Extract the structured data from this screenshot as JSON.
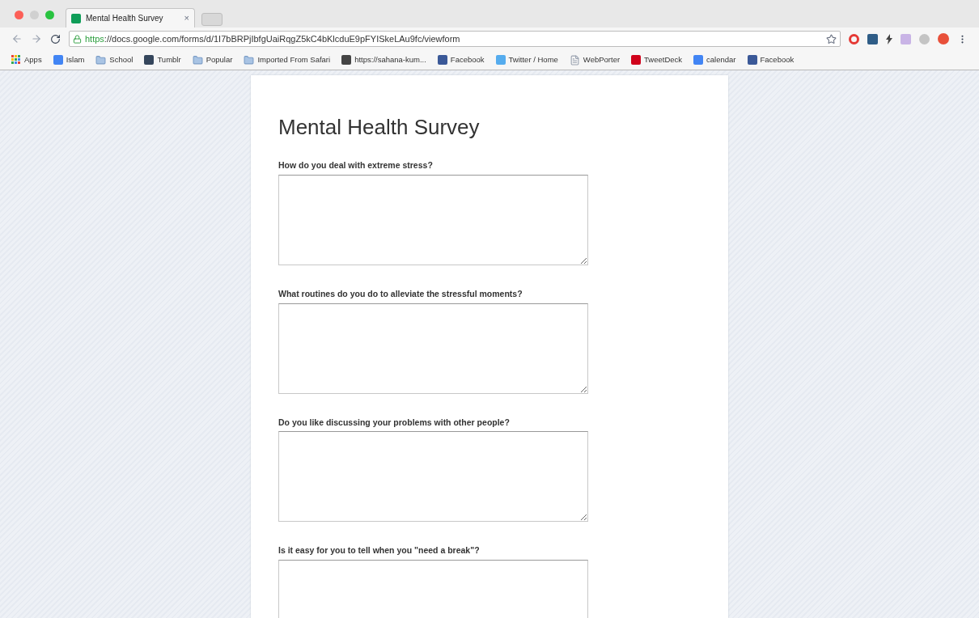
{
  "tab": {
    "title": "Mental Health Survey",
    "close": "×"
  },
  "address": {
    "scheme": "https",
    "rest": "://docs.google.com/forms/d/1I7bBRPjIbfgUaiRqgZ5kC4bKlcduE9pFYISkeLAu9fc/viewform"
  },
  "bookmarks": [
    {
      "label": "Apps",
      "kind": "apps"
    },
    {
      "label": "Islam",
      "kind": "site",
      "color": "#4285f4"
    },
    {
      "label": "School",
      "kind": "folder"
    },
    {
      "label": "Tumblr",
      "kind": "site",
      "color": "#35465c"
    },
    {
      "label": "Popular",
      "kind": "folder"
    },
    {
      "label": "Imported From Safari",
      "kind": "folder"
    },
    {
      "label": "https://sahana-kum...",
      "kind": "site",
      "color": "#444444"
    },
    {
      "label": "Facebook",
      "kind": "site",
      "color": "#3b5998"
    },
    {
      "label": "Twitter / Home",
      "kind": "site",
      "color": "#55acee"
    },
    {
      "label": "WebPorter",
      "kind": "page"
    },
    {
      "label": "TweetDeck",
      "kind": "site",
      "color": "#d0021b"
    },
    {
      "label": "calendar",
      "kind": "site",
      "color": "#4285f4"
    },
    {
      "label": "Facebook",
      "kind": "site",
      "color": "#3b5998"
    }
  ],
  "form": {
    "title": "Mental Health Survey",
    "questions": [
      {
        "label": "How do you deal with extreme stress?"
      },
      {
        "label": "What routines do you do to alleviate the stressful moments?"
      },
      {
        "label": "Do you like discussing your problems with other people?"
      },
      {
        "label": "Is it easy for you to tell when you \"need a break\"?"
      }
    ]
  }
}
